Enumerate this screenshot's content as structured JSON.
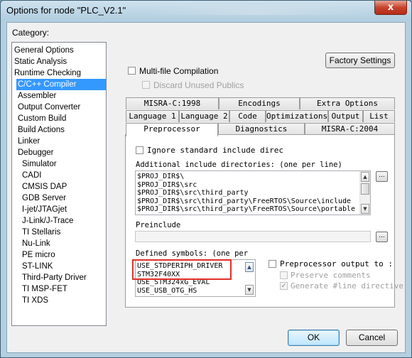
{
  "window": {
    "title": "Options for node \"PLC_V2.1\"",
    "close_glyph": "x"
  },
  "category": {
    "label": "Category:",
    "items": [
      "General Options",
      "Static Analysis",
      "Runtime Checking",
      "C/C++ Compiler",
      "Assembler",
      "Output Converter",
      "Custom Build",
      "Build Actions",
      "Linker",
      "Debugger",
      "Simulator",
      "CADI",
      "CMSIS DAP",
      "GDB Server",
      "I-jet/JTAGjet",
      "J-Link/J-Trace",
      "TI Stellaris",
      "Nu-Link",
      "PE micro",
      "ST-LINK",
      "Third-Party Driver",
      "TI MSP-FET",
      "TI XDS"
    ],
    "selected": "C/C++ Compiler"
  },
  "factory_settings_label": "Factory Settings",
  "multi_file": {
    "label": "Multi-file Compilation",
    "checked": false
  },
  "discard_unused": {
    "label": "Discard Unused Publics",
    "checked": false
  },
  "tabs": {
    "row1": [
      "MISRA-C:1998",
      "Encodings",
      "Extra Options"
    ],
    "row2": [
      "Language 1",
      "Language 2",
      "Code",
      "Optimizations",
      "Output",
      "List"
    ],
    "row3": [
      "Preprocessor",
      "Diagnostics",
      "MISRA-C:2004"
    ],
    "active": "Preprocessor"
  },
  "preprocessor": {
    "ignore_std_include": {
      "label": "Ignore standard include direc",
      "checked": false
    },
    "include_dirs_label": "Additional include directories: (one per line)",
    "include_dirs": [
      "$PROJ_DIR$\\",
      "$PROJ_DIR$\\src",
      "$PROJ_DIR$\\src\\third_party",
      "$PROJ_DIR$\\src\\third_party\\FreeRTOS\\Source\\include",
      "$PROJ_DIR$\\src\\third_party\\FreeRTOS\\Source\\portable"
    ],
    "browse_label": "...",
    "preinclude_label": "Preinclude",
    "preinclude_value": "",
    "defined_symbols_label": "Defined symbols: (one per",
    "defined_symbols": [
      "USE_STDPERIPH_DRIVER",
      "STM32F40XX",
      "USE_STM324xG_EVAL",
      "USE_USB_OTG_HS"
    ],
    "pp_output": {
      "label": "Preprocessor output to :",
      "checked": false
    },
    "preserve_comments": {
      "label": "Preserve comments",
      "checked": false
    },
    "generate_line": {
      "label": "Generate #line directive",
      "checked": true
    }
  },
  "buttons": {
    "ok": "OK",
    "cancel": "Cancel"
  }
}
